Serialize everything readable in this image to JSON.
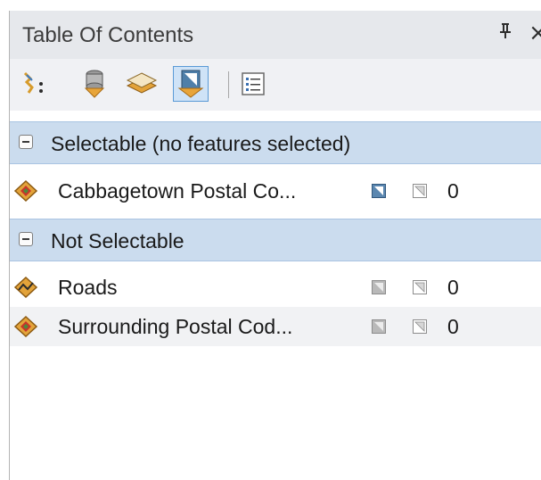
{
  "window": {
    "title": "Table Of Contents",
    "pin_glyph": "Ŧ",
    "close_glyph": "×"
  },
  "toolbar": {
    "buttons": [
      {
        "icon": "list-by-drawing-order-icon",
        "active": false
      },
      {
        "icon": "list-by-source-icon",
        "active": false
      },
      {
        "icon": "list-by-visibility-icon",
        "active": false
      },
      {
        "icon": "list-by-selection-icon",
        "active": true
      },
      {
        "icon": "options-icon",
        "active": false
      }
    ]
  },
  "groups": [
    {
      "label": "Selectable (no features selected)",
      "layers": [
        {
          "name": "Cabbagetown Postal Co...",
          "icon": "polygon-layer-icon",
          "selectable_toggle": "on",
          "count": "0"
        }
      ]
    },
    {
      "label": "Not Selectable",
      "layers": [
        {
          "name": "Roads",
          "icon": "line-layer-icon",
          "selectable_toggle": "off",
          "count": "0"
        },
        {
          "name": "Surrounding Postal Cod...",
          "icon": "polygon-layer-icon",
          "selectable_toggle": "off",
          "count": "0"
        }
      ]
    }
  ],
  "colors": {
    "group_header_bg": "#cbdcee",
    "active_tool_bg": "#cfe3f7",
    "active_tool_border": "#5a9ad6"
  }
}
